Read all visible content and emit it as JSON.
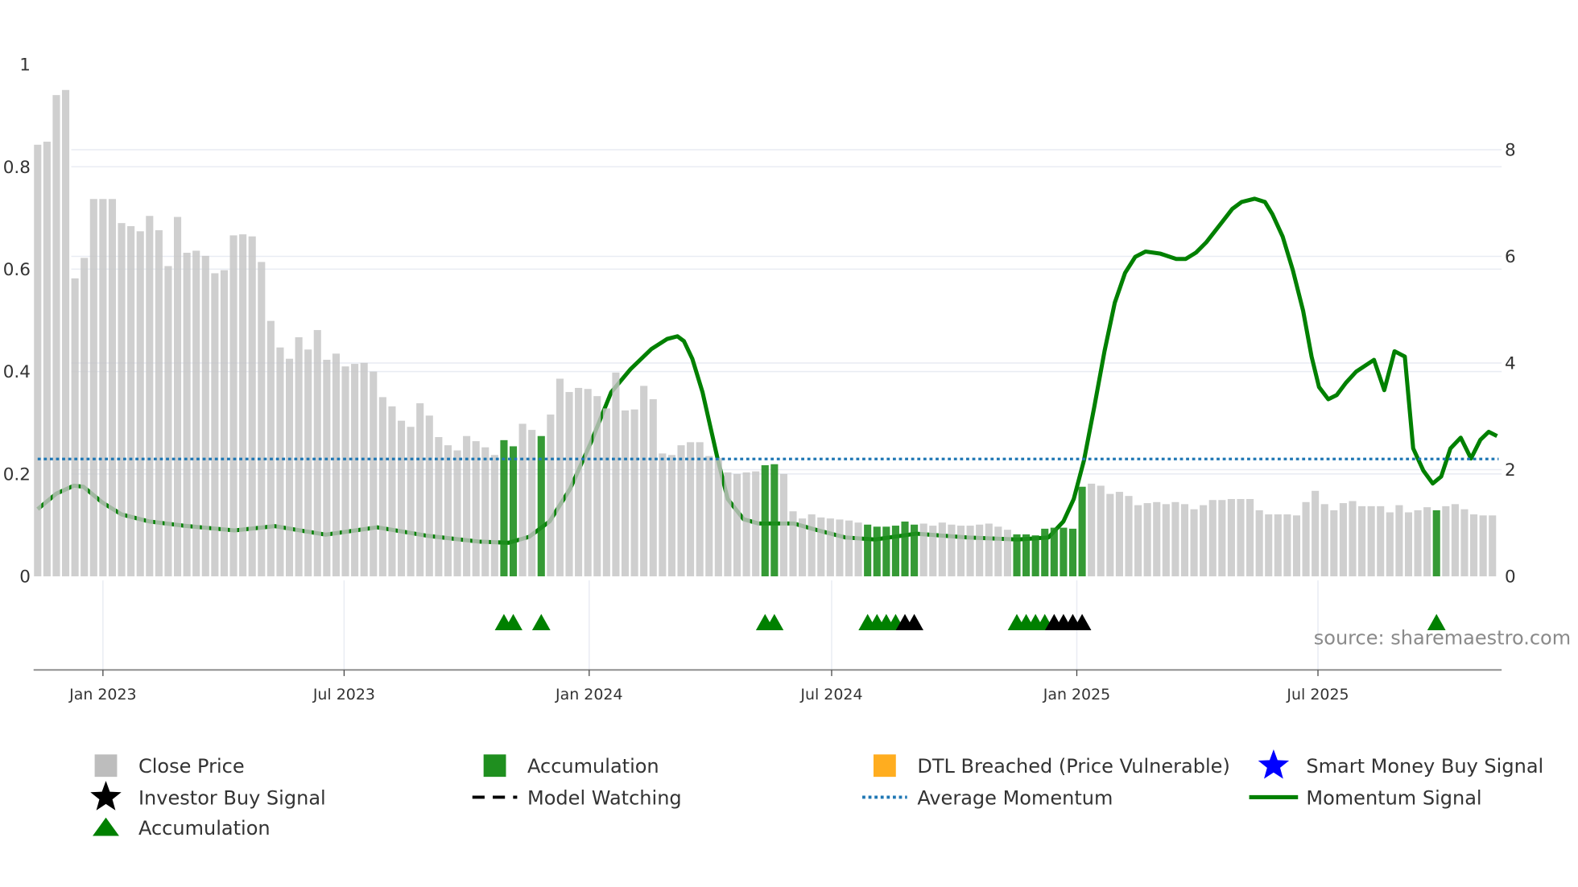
{
  "chart_data": {
    "type": "bar",
    "title": "",
    "start_date": "2022-11-13",
    "interval": "weekly",
    "left_axis": {
      "ylim": [
        0,
        1
      ],
      "ticks": [
        0,
        0.2,
        0.4,
        0.6,
        0.8,
        1
      ],
      "tick_labels": [
        "0",
        "0.2",
        "0.4",
        "0.6",
        "0.8",
        "1"
      ]
    },
    "right_axis": {
      "ylim": [
        0,
        9.6
      ],
      "ticks": [
        0,
        2,
        4,
        6,
        8
      ],
      "tick_labels": [
        "0",
        "2",
        "4",
        "6",
        "8"
      ]
    },
    "x_ticks": [
      {
        "label": "Jan 2023",
        "week": 7.0
      },
      {
        "label": "Jul 2023",
        "week": 32.86
      },
      {
        "label": "Jan 2024",
        "week": 59.14
      },
      {
        "label": "Jul 2024",
        "week": 85.14
      },
      {
        "label": "Jan 2025",
        "week": 111.43
      },
      {
        "label": "Jul 2025",
        "week": 137.29
      }
    ],
    "grid": true,
    "close_price": [
      0.843,
      0.849,
      0.94,
      0.95,
      0.582,
      0.622,
      0.737,
      0.737,
      0.737,
      0.69,
      0.684,
      0.674,
      0.704,
      0.676,
      0.606,
      0.702,
      0.632,
      0.636,
      0.626,
      0.592,
      0.598,
      0.666,
      0.668,
      0.664,
      0.614,
      0.499,
      0.447,
      0.425,
      0.467,
      0.443,
      0.481,
      0.423,
      0.435,
      0.41,
      0.415,
      0.417,
      0.4,
      0.35,
      0.332,
      0.304,
      0.292,
      0.338,
      0.314,
      0.272,
      0.256,
      0.246,
      0.274,
      0.264,
      0.252,
      0.237,
      0.266,
      0.254,
      0.298,
      0.286,
      0.274,
      0.316,
      0.386,
      0.36,
      0.368,
      0.366,
      0.352,
      0.328,
      0.398,
      0.324,
      0.326,
      0.372,
      0.346,
      0.24,
      0.237,
      0.256,
      0.262,
      0.262,
      0.235,
      0.231,
      0.203,
      0.2,
      0.203,
      0.205,
      0.217,
      0.219,
      0.2,
      0.127,
      0.113,
      0.121,
      0.115,
      0.113,
      0.111,
      0.109,
      0.105,
      0.101,
      0.097,
      0.097,
      0.099,
      0.107,
      0.101,
      0.103,
      0.099,
      0.105,
      0.101,
      0.099,
      0.099,
      0.101,
      0.103,
      0.097,
      0.091,
      0.082,
      0.082,
      0.08,
      0.093,
      0.095,
      0.095,
      0.093,
      0.175,
      0.181,
      0.177,
      0.161,
      0.165,
      0.157,
      0.139,
      0.143,
      0.145,
      0.141,
      0.145,
      0.141,
      0.131,
      0.139,
      0.149,
      0.149,
      0.151,
      0.151,
      0.151,
      0.129,
      0.121,
      0.121,
      0.121,
      0.119,
      0.145,
      0.167,
      0.141,
      0.129,
      0.143,
      0.147,
      0.137,
      0.137,
      0.137,
      0.125,
      0.139,
      0.125,
      0.129,
      0.135,
      0.129,
      0.137,
      0.141,
      0.131,
      0.121,
      0.119,
      0.119
    ],
    "accumulation_weeks": [
      50,
      51,
      54,
      78,
      79,
      89,
      90,
      91,
      92,
      93,
      94,
      105,
      106,
      107,
      108,
      109,
      110,
      111,
      112,
      150
    ],
    "momentum_signal": [
      [
        0,
        1.26
      ],
      [
        2.0,
        1.55
      ],
      [
        3.9,
        1.7
      ],
      [
        4.9,
        1.68
      ],
      [
        6.9,
        1.39
      ],
      [
        9.0,
        1.16
      ],
      [
        11.9,
        1.03
      ],
      [
        15.6,
        0.95
      ],
      [
        21.1,
        0.86
      ],
      [
        25.4,
        0.94
      ],
      [
        30.9,
        0.78
      ],
      [
        36.4,
        0.92
      ],
      [
        41.8,
        0.76
      ],
      [
        47.3,
        0.65
      ],
      [
        50.5,
        0.63
      ],
      [
        52.7,
        0.74
      ],
      [
        54.9,
        1.03
      ],
      [
        57.1,
        1.64
      ],
      [
        59.3,
        2.5
      ],
      [
        61.5,
        3.45
      ],
      [
        63.6,
        3.89
      ],
      [
        65.8,
        4.26
      ],
      [
        67.5,
        4.45
      ],
      [
        68.6,
        4.5
      ],
      [
        69.3,
        4.41
      ],
      [
        70.2,
        4.08
      ],
      [
        71.3,
        3.45
      ],
      [
        72.9,
        2.21
      ],
      [
        74.0,
        1.45
      ],
      [
        75.7,
        1.07
      ],
      [
        77.3,
        0.99
      ],
      [
        81.1,
        0.99
      ],
      [
        83.3,
        0.88
      ],
      [
        86.6,
        0.73
      ],
      [
        89.8,
        0.69
      ],
      [
        94.2,
        0.8
      ],
      [
        99.7,
        0.73
      ],
      [
        105.1,
        0.69
      ],
      [
        108.4,
        0.73
      ],
      [
        110.0,
        1.03
      ],
      [
        111.1,
        1.45
      ],
      [
        112.2,
        2.18
      ],
      [
        113.3,
        3.17
      ],
      [
        114.4,
        4.22
      ],
      [
        115.5,
        5.13
      ],
      [
        116.6,
        5.69
      ],
      [
        117.7,
        5.99
      ],
      [
        118.8,
        6.09
      ],
      [
        120.4,
        6.05
      ],
      [
        122.1,
        5.95
      ],
      [
        123.1,
        5.95
      ],
      [
        124.2,
        6.07
      ],
      [
        125.3,
        6.26
      ],
      [
        127.0,
        6.64
      ],
      [
        128.1,
        6.89
      ],
      [
        129.1,
        7.02
      ],
      [
        130.5,
        7.08
      ],
      [
        131.6,
        7.02
      ],
      [
        132.4,
        6.79
      ],
      [
        133.5,
        6.37
      ],
      [
        134.6,
        5.74
      ],
      [
        135.7,
        4.98
      ],
      [
        136.6,
        4.12
      ],
      [
        137.4,
        3.55
      ],
      [
        138.4,
        3.32
      ],
      [
        139.3,
        3.4
      ],
      [
        140.3,
        3.63
      ],
      [
        141.4,
        3.84
      ],
      [
        143.3,
        4.06
      ],
      [
        144.4,
        3.49
      ],
      [
        145.5,
        4.22
      ],
      [
        146.6,
        4.12
      ],
      [
        147.5,
        2.4
      ],
      [
        148.6,
        1.98
      ],
      [
        149.6,
        1.74
      ],
      [
        150.5,
        1.87
      ],
      [
        151.5,
        2.4
      ],
      [
        152.6,
        2.6
      ],
      [
        153.7,
        2.21
      ],
      [
        154.7,
        2.56
      ],
      [
        155.6,
        2.71
      ],
      [
        156.5,
        2.63
      ]
    ],
    "average_momentum": 2.2,
    "markers": [
      {
        "week": 50,
        "type": "accumulation"
      },
      {
        "week": 51,
        "type": "accumulation"
      },
      {
        "week": 54,
        "type": "accumulation"
      },
      {
        "week": 78,
        "type": "accumulation"
      },
      {
        "week": 79,
        "type": "accumulation"
      },
      {
        "week": 89,
        "type": "accumulation"
      },
      {
        "week": 90,
        "type": "accumulation"
      },
      {
        "week": 91,
        "type": "accumulation"
      },
      {
        "week": 92,
        "type": "accumulation"
      },
      {
        "week": 93,
        "type": "investor"
      },
      {
        "week": 94,
        "type": "investor"
      },
      {
        "week": 105,
        "type": "accumulation"
      },
      {
        "week": 106,
        "type": "accumulation"
      },
      {
        "week": 107,
        "type": "accumulation"
      },
      {
        "week": 108,
        "type": "accumulation"
      },
      {
        "week": 109,
        "type": "investor"
      },
      {
        "week": 110,
        "type": "investor"
      },
      {
        "week": 111,
        "type": "investor"
      },
      {
        "week": 112,
        "type": "investor"
      },
      {
        "week": 150,
        "type": "accumulation"
      }
    ],
    "legend": [
      {
        "label": "Close Price",
        "icon": "gray-square",
        "color": "#bdbdbd"
      },
      {
        "label": "Accumulation",
        "icon": "green-square",
        "color": "#1f8f1f"
      },
      {
        "label": "DTL Breached (Price Vulnerable)",
        "icon": "orange-square",
        "color": "#ffad1f"
      },
      {
        "label": "Smart Money Buy Signal",
        "icon": "blue-star",
        "color": "#0000ff"
      },
      {
        "label": "Investor Buy Signal",
        "icon": "black-star",
        "color": "#000000"
      },
      {
        "label": "Model Watching",
        "icon": "black-dashed-line",
        "color": "#000000"
      },
      {
        "label": "Average Momentum",
        "icon": "blue-dotted-line",
        "color": "#1f77b4"
      },
      {
        "label": "Momentum Signal",
        "icon": "green-line",
        "color": "#008000"
      },
      {
        "label": "Accumulation",
        "icon": "green-triangle",
        "color": "#008000"
      }
    ],
    "legend_position": "bottom",
    "source": "source: sharemaestro.com"
  },
  "colors": {
    "bar": "#c4c4c4",
    "accumulation_bar": "#1f8f1f",
    "momentum": "#008000",
    "average": "#1f77b4",
    "grid": "#e9ecf3",
    "axis": "#888888"
  }
}
